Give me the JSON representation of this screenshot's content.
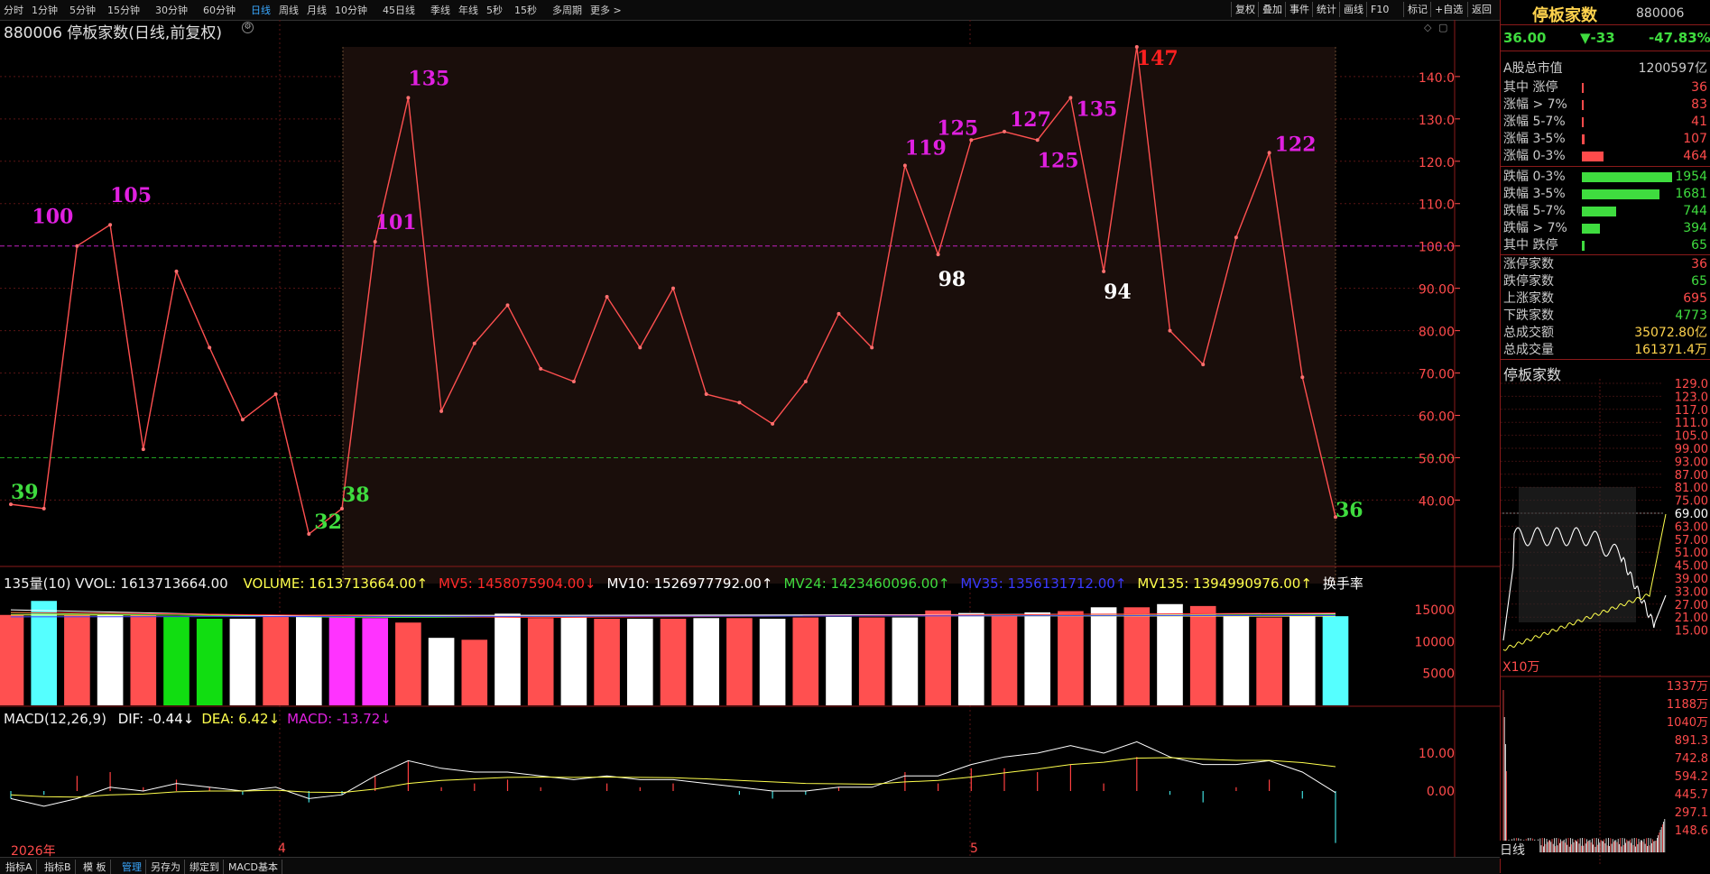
{
  "toolbar": {
    "periods": [
      "分时",
      "1分钟",
      "5分钟",
      "15分钟",
      "30分钟",
      "60分钟",
      "日线",
      "周线",
      "月线",
      "10分钟",
      "45日线",
      "季线",
      "年线",
      "5秒",
      "15秒",
      "多周期",
      "更多 >"
    ],
    "active_period": "日线",
    "right_buttons": [
      "复权",
      "叠加",
      "事件",
      "统计",
      "画线",
      "F10",
      "标记",
      "+自选",
      "返回"
    ]
  },
  "chart_header": {
    "title": "880006 停板家数(日线,前复权)"
  },
  "y_axis_labels": [
    "140.0",
    "130.0",
    "120.0",
    "110.0",
    "100.0",
    "90.00",
    "80.00",
    "70.00",
    "60.00",
    "50.00",
    "40.00"
  ],
  "point_labels": [
    {
      "text": "100",
      "color": "#e020e0"
    },
    {
      "text": "105",
      "color": "#e020e0"
    },
    {
      "text": "39",
      "color": "#3fdc3f"
    },
    {
      "text": "32",
      "color": "#3fdc3f"
    },
    {
      "text": "38",
      "color": "#3fdc3f"
    },
    {
      "text": "101",
      "color": "#e020e0"
    },
    {
      "text": "135",
      "color": "#e020e0"
    },
    {
      "text": "119",
      "color": "#e020e0"
    },
    {
      "text": "98",
      "color": "#ffffff"
    },
    {
      "text": "125",
      "color": "#e020e0"
    },
    {
      "text": "127",
      "color": "#e020e0"
    },
    {
      "text": "125",
      "color": "#e020e0"
    },
    {
      "text": "135",
      "color": "#e020e0"
    },
    {
      "text": "94",
      "color": "#ffffff"
    },
    {
      "text": "147",
      "color": "#ff2020"
    },
    {
      "text": "122",
      "color": "#e020e0"
    },
    {
      "text": "36",
      "color": "#3fdc3f"
    }
  ],
  "volume_header": {
    "name": "135量(10) VVOL: 1613713664.00",
    "items": [
      {
        "text": "VOLUME: 1613713664.00↑",
        "color": "#ffff4d"
      },
      {
        "text": "MV5: 1458075904.00↓",
        "color": "#ff2a2a"
      },
      {
        "text": "MV10: 1526977792.00↑",
        "color": "#ffffff"
      },
      {
        "text": "MV24: 1423460096.00↑",
        "color": "#3fdc3f"
      },
      {
        "text": "MV35: 1356131712.00↑",
        "color": "#3a3aff"
      },
      {
        "text": "MV135: 1394990976.00↑",
        "color": "#ffff4d"
      },
      {
        "text": "换手率",
        "color": "#ffffff"
      }
    ],
    "axis": [
      "15000",
      "10000",
      "5000"
    ]
  },
  "macd_header": {
    "name": "MACD(12,26,9)",
    "items": [
      {
        "text": "DIF: -0.44↓",
        "color": "#ffffff"
      },
      {
        "text": "DEA: 6.42↓",
        "color": "#ffff4d"
      },
      {
        "text": "MACD: -13.72↓",
        "color": "#e020e0"
      }
    ],
    "axis": [
      "10.00",
      "0.00"
    ]
  },
  "x_axis": {
    "year": "2026年",
    "m4": "4",
    "m5": "5"
  },
  "right_panel": {
    "title": "停板家数",
    "code": "880006",
    "price": "36.00",
    "change": "▼-33",
    "pct": "-47.83%",
    "market_cap_label": "A股总市值",
    "market_cap": "1200597亿",
    "dist": [
      {
        "label": "其中 涨停",
        "value": "36",
        "side": "up",
        "frac": 0.01
      },
      {
        "label": "涨幅 > 7%",
        "value": "83",
        "side": "up",
        "frac": 0.02
      },
      {
        "label": "涨幅 5-7%",
        "value": "41",
        "side": "up",
        "frac": 0.01
      },
      {
        "label": "涨幅 3-5%",
        "value": "107",
        "side": "up",
        "frac": 0.03
      },
      {
        "label": "涨幅 0-3%",
        "value": "464",
        "side": "up",
        "frac": 0.24
      },
      {
        "label": "跌幅 0-3%",
        "value": "1954",
        "side": "down",
        "frac": 1.0
      },
      {
        "label": "跌幅 3-5%",
        "value": "1681",
        "side": "down",
        "frac": 0.86
      },
      {
        "label": "跌幅 5-7%",
        "value": "744",
        "side": "down",
        "frac": 0.38
      },
      {
        "label": "跌幅 > 7%",
        "value": "394",
        "side": "down",
        "frac": 0.2
      },
      {
        "label": "其中 跌停",
        "value": "65",
        "side": "down",
        "frac": 0.03
      }
    ],
    "stats": [
      {
        "label": "涨停家数",
        "value": "36",
        "color": "#ff4b4b"
      },
      {
        "label": "跌停家数",
        "value": "65",
        "color": "#3fdc3f"
      },
      {
        "label": "上涨家数",
        "value": "695",
        "color": "#ff4b4b"
      },
      {
        "label": "下跌家数",
        "value": "4773",
        "color": "#3fdc3f"
      },
      {
        "label": "总成交额",
        "value": "35072.80亿",
        "color": "#ffd34d"
      },
      {
        "label": "总成交量",
        "value": "161371.4万",
        "color": "#ffd34d"
      }
    ],
    "mini_title": "停板家数",
    "mini_axis": [
      "129.0",
      "123.0",
      "117.0",
      "111.0",
      "105.0",
      "99.00",
      "93.00",
      "87.00",
      "81.00",
      "75.00",
      "69.00",
      "63.00",
      "57.00",
      "51.00",
      "45.00",
      "39.00",
      "33.00",
      "27.00",
      "21.00",
      "15.00"
    ],
    "mini_unit": "X10万",
    "mini_vol_axis": [
      "1337万",
      "1188万",
      "1040万",
      "891.3",
      "742.8",
      "594.2",
      "445.7",
      "297.1",
      "148.6"
    ],
    "mini_period": "日线"
  },
  "bottom_tabs": [
    "指标A",
    "指标B",
    "模 板",
    "管理",
    "另存为",
    "绑定到",
    "MACD基本"
  ],
  "bottom_active": "管理",
  "chart_data": {
    "type": "line",
    "title": "880006 停板家数(日线,前复权)",
    "values": [
      39,
      38,
      100,
      105,
      52,
      94,
      76,
      59,
      65,
      32,
      38,
      101,
      135,
      61,
      77,
      86,
      71,
      68,
      88,
      76,
      90,
      65,
      63,
      58,
      68,
      84,
      76,
      119,
      98,
      125,
      127,
      125,
      135,
      94,
      147,
      80,
      72,
      102,
      122,
      69,
      36
    ],
    "volume": [
      1420,
      1640,
      1420,
      1420,
      1420,
      1390,
      1360,
      1360,
      1400,
      1400,
      1390,
      1370,
      1300,
      1060,
      1030,
      1440,
      1370,
      1380,
      1360,
      1360,
      1360,
      1370,
      1370,
      1360,
      1380,
      1390,
      1380,
      1380,
      1490,
      1450,
      1420,
      1460,
      1480,
      1540,
      1540,
      1590,
      1560,
      1400,
      1380,
      1400,
      1400,
      1614
    ],
    "macd_hist": [
      -2,
      -1,
      4,
      5,
      1,
      3,
      1,
      -1,
      0,
      -3,
      -1,
      4,
      8,
      1,
      2,
      3,
      1,
      0,
      2,
      1,
      2,
      0,
      -1,
      -2,
      -1,
      1,
      0,
      5,
      2,
      6,
      6,
      5,
      7,
      2,
      9,
      -1,
      -3,
      1,
      3,
      -2,
      -13.72
    ],
    "dif": [
      -2,
      -4,
      -2,
      1,
      0,
      2,
      1,
      0,
      1,
      -2,
      -1,
      4,
      8,
      6,
      5,
      5,
      4,
      3,
      4,
      3,
      3,
      2,
      1,
      0,
      0,
      1,
      1,
      4,
      4,
      7,
      9,
      10,
      12,
      10,
      13,
      9,
      7,
      7,
      8,
      5,
      -0.44
    ],
    "dea": [
      -1,
      -1.5,
      -1.6,
      -1,
      -0.8,
      -0.2,
      0,
      0,
      0.2,
      -0.3,
      -0.4,
      0.5,
      2,
      2.8,
      3.2,
      3.6,
      3.7,
      3.6,
      3.7,
      3.6,
      3.5,
      3.2,
      2.8,
      2.4,
      2,
      1.9,
      1.8,
      2.4,
      2.8,
      3.7,
      4.8,
      5.8,
      7,
      7.6,
      8.7,
      8.8,
      8.4,
      8.1,
      8.1,
      7.5,
      6.42
    ],
    "ylim": [
      32,
      147
    ],
    "hlines": [
      100,
      50
    ]
  }
}
